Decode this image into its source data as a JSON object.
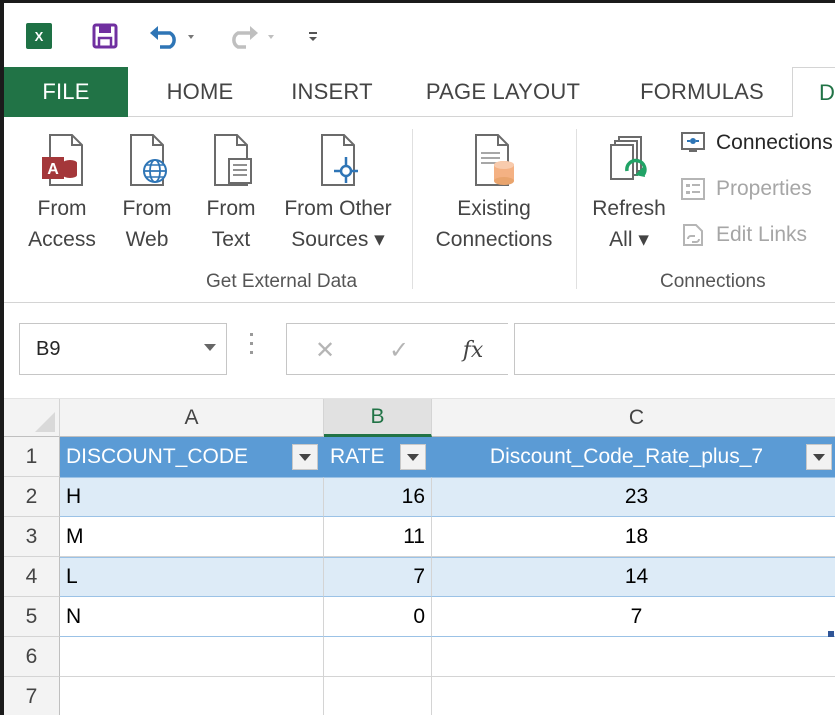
{
  "quick_access": {
    "app_icon_label": "X",
    "icons": [
      "excel-icon",
      "save-icon",
      "undo-icon",
      "redo-icon",
      "customize-icon"
    ]
  },
  "tabs": [
    {
      "label": "FILE"
    },
    {
      "label": "HOME"
    },
    {
      "label": "INSERT"
    },
    {
      "label": "PAGE LAYOUT"
    },
    {
      "label": "FORMULAS"
    },
    {
      "label": "DA"
    }
  ],
  "ribbon": {
    "get_external_data": {
      "label": "Get External Data",
      "buttons": [
        {
          "line1": "From",
          "line2": "Access",
          "icon": "access-icon"
        },
        {
          "line1": "From",
          "line2": "Web",
          "icon": "web-icon"
        },
        {
          "line1": "From",
          "line2": "Text",
          "icon": "text-file-icon"
        },
        {
          "line1": "From Other",
          "line2": "Sources ▾",
          "icon": "other-sources-icon"
        }
      ]
    },
    "existing_connections": {
      "line1": "Existing",
      "line2": "Connections",
      "icon": "existing-connections-icon"
    },
    "connections": {
      "label": "Connections",
      "refresh": {
        "line1": "Refresh",
        "line2": "All ▾",
        "icon": "refresh-icon"
      },
      "items": [
        {
          "label": "Connections",
          "icon": "connections-icon",
          "enabled": true
        },
        {
          "label": "Properties",
          "icon": "properties-icon",
          "enabled": false
        },
        {
          "label": "Edit Links",
          "icon": "edit-links-icon",
          "enabled": false
        }
      ]
    }
  },
  "formula_bar": {
    "name_box": "B9",
    "cancel_symbol": "✕",
    "enter_symbol": "✓",
    "fx_symbol": "fx",
    "value": ""
  },
  "sheet": {
    "columns": [
      "A",
      "B",
      "C"
    ],
    "selected_column": "B",
    "rows": [
      "1",
      "2",
      "3",
      "4",
      "5",
      "6",
      "7"
    ],
    "headers": [
      "DISCOUNT_CODE",
      "RATE",
      "Discount_Code_Rate_plus_7"
    ],
    "data": [
      [
        "H",
        "16",
        "23"
      ],
      [
        "M",
        "11",
        "18"
      ],
      [
        "L",
        "7",
        "14"
      ],
      [
        "N",
        "0",
        "7"
      ]
    ]
  },
  "colors": {
    "excel_green": "#217346",
    "table_header": "#5b9bd5",
    "table_band": "#ddebf7"
  }
}
